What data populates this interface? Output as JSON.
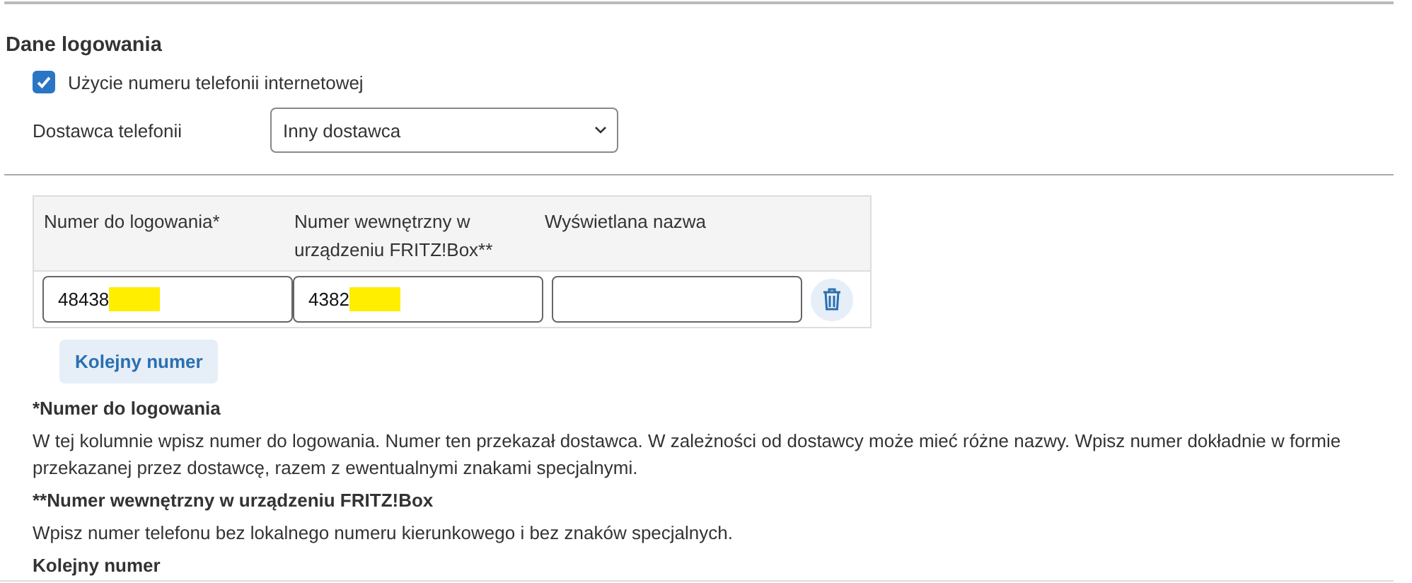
{
  "section": {
    "title": "Dane logowania"
  },
  "checkbox": {
    "label": "Użycie numeru telefonii internetowej",
    "checked": true
  },
  "provider": {
    "label": "Dostawca telefonii",
    "value": "Inny dostawca"
  },
  "table": {
    "columns": [
      "Numer do logowania*",
      "Numer wewnętrzny w urządzeniu FRITZ!Box**",
      "Wyświetlana nazwa"
    ],
    "rows": [
      {
        "cells": [
          {
            "value": "48438",
            "redacted": true
          },
          {
            "value": "4382",
            "redacted": true
          },
          {
            "redacted": false
          }
        ]
      }
    ]
  },
  "add_button": "Kolejny numer",
  "notes": [
    {
      "title": "*Numer do logowania",
      "text": "W tej kolumnie wpisz numer do logowania. Numer ten przekazał dostawca. W zależności od dostawcy może mieć różne nazwy. Wpisz numer dokładnie w formie przekazanej przez dostawcę, razem z ewentualnymi znakami specjalnymi."
    },
    {
      "title": "**Numer wewnętrzny w urządzeniu FRITZ!Box",
      "text": "Wpisz numer telefonu bez lokalnego numeru kierunkowego i bez znaków specjalnych."
    },
    {
      "title": "Kolejny numer"
    }
  ]
}
